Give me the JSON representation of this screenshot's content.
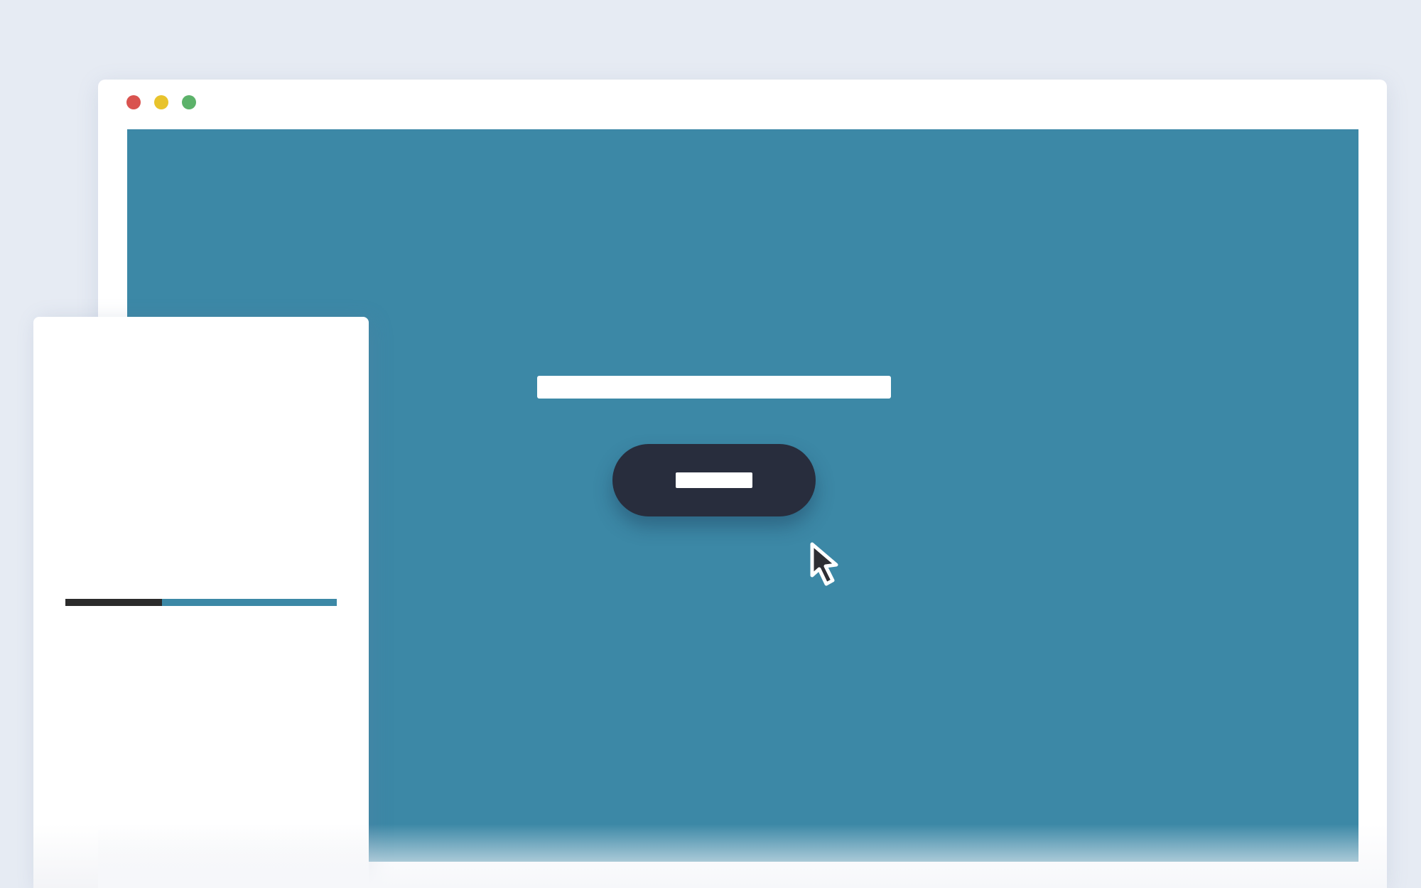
{
  "colors": {
    "page_background": "#e6ebf3",
    "window_background": "#ffffff",
    "viewport_background": "#3c88a6",
    "button_background": "#282d3d",
    "progress_filled": "#2b2b2b",
    "progress_track": "#3c88a6",
    "traffic_close": "#d9534f",
    "traffic_minimize": "#e8c32c",
    "traffic_maximize": "#5cb26a"
  },
  "window": {
    "controls": [
      "close-dot",
      "minimize-dot",
      "maximize-dot"
    ]
  },
  "main": {
    "input": {
      "value": "",
      "placeholder": ""
    },
    "button": {
      "label": ""
    },
    "cursor": {
      "icon": "arrow-cursor-icon"
    }
  },
  "side_panel": {
    "progress": {
      "fraction": 0.355
    }
  }
}
